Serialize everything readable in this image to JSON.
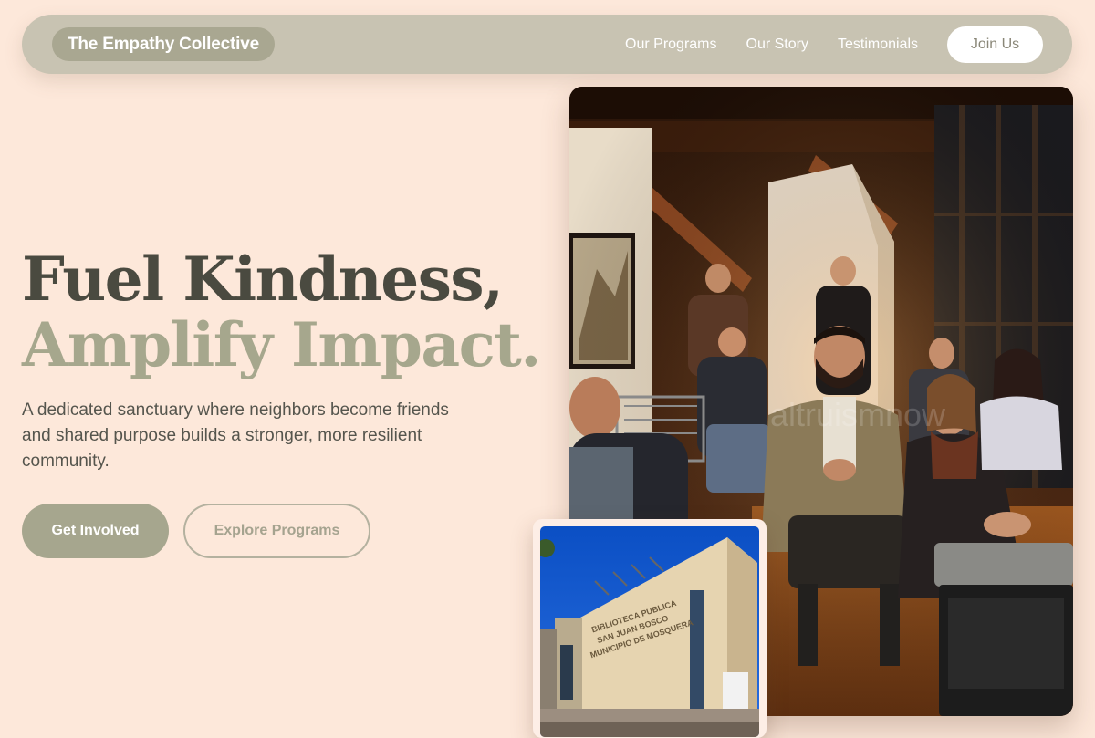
{
  "nav": {
    "brand": "The Empathy Collective",
    "links": [
      "Our Programs",
      "Our Story",
      "Testimonials"
    ],
    "cta": "Join Us"
  },
  "hero": {
    "headline_line1": "Fuel Kindness,",
    "headline_line2": "Amplify Impact.",
    "subtext": "A dedicated sanctuary where neighbors become friends and shared purpose builds a stronger, more resilient community.",
    "primary_button": "Get Involved",
    "secondary_button": "Explore Programs"
  },
  "images": {
    "main_photo": "community-gathering-photo",
    "main_photo_watermark": "altruismnow",
    "secondary_photo": "library-building-photo",
    "building_sign": [
      "BIBLIOTECA PUBLICA",
      "SAN JUAN BOSCO",
      "MUNICIPIO DE MOSQUERA"
    ]
  },
  "colors": {
    "page_bg": "#fde8da",
    "nav_bg": "#c8c3b2",
    "brand_pill": "#a9a791",
    "headline_dark": "#4a4a40",
    "headline_light": "#a6a78d",
    "primary_button": "#a6a68e"
  }
}
